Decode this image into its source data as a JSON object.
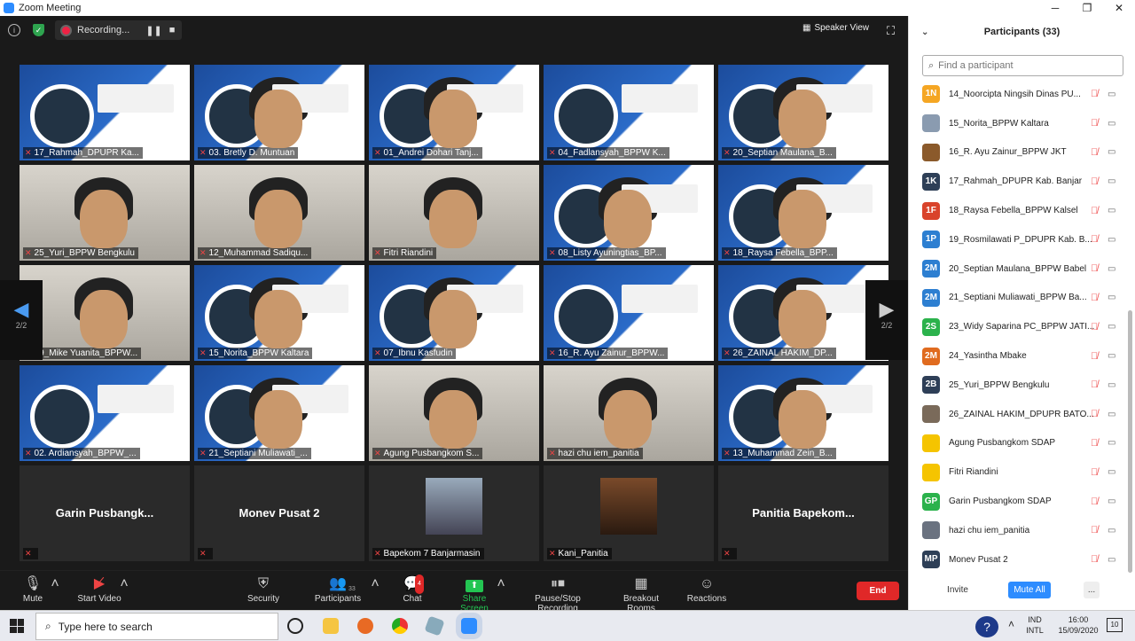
{
  "window": {
    "title": "Zoom Meeting",
    "minimize": "─",
    "maximize": "❐",
    "close": "✕"
  },
  "topbar": {
    "info": "i",
    "recording": "Recording...",
    "speaker_view": "Speaker View"
  },
  "tiles": [
    "17_Rahmah_DPUPR Ka...",
    "03. Bretly D. Muntuan",
    "01_Andrei Dohari Tanj...",
    "04_Fadlansyah_BPPW K...",
    "20_Septian Maulana_B...",
    "25_Yuri_BPPW Bengkulu",
    "12_Muhammad Sadiqu...",
    "Fitri Riandini",
    "08_Listy Ayuningtias_BP...",
    "18_Raysa Febella_BPP...",
    "09_Mike Yuanita_BPPW...",
    "15_Norita_BPPW Kaltara",
    "07_Ibnu Kasfudin",
    "16_R. Ayu Zainur_BPPW...",
    "26_ZAINAL HAKIM_DP...",
    "02. Ardiansyah_BPPW_...",
    "21_Septiani Muliawati_...",
    "Agung Pusbangkom S...",
    "hazi chu iem_panitia",
    "13_Muhammad Zein_B..."
  ],
  "empty_tiles": [
    "Garin  Pusbangk...",
    "Monev Pusat 2",
    "",
    "",
    "Panitia  Bapekom..."
  ],
  "picture_tiles": [
    "Bapekom 7 Banjarmasin",
    "Kani_Panitia"
  ],
  "page_indicator": "2/2",
  "toolbar": {
    "mute": "Mute",
    "start_video": "Start Video",
    "security": "Security",
    "participants": "Participants",
    "participants_count": "33",
    "chat": "Chat",
    "chat_badge": "4",
    "share": "Share Screen",
    "record": "Pause/Stop Recording",
    "breakout": "Breakout Rooms",
    "reactions": "Reactions",
    "end": "End"
  },
  "panel": {
    "title": "Participants (33)",
    "search_placeholder": "Find a participant",
    "participants": [
      {
        "initials": "1N",
        "color": "#f5a623",
        "name": "14_Noorcipta Ningsih Dinas PU..."
      },
      {
        "initials": "",
        "color": "#8a9bb0",
        "name": "15_Norita_BPPW Kaltara"
      },
      {
        "initials": "",
        "color": "#8b5a2b",
        "name": "16_R. Ayu Zainur_BPPW JKT"
      },
      {
        "initials": "1K",
        "color": "#2e3f57",
        "name": "17_Rahmah_DPUPR Kab. Banjar"
      },
      {
        "initials": "1F",
        "color": "#d9432b",
        "name": "18_Raysa Febella_BPPW Kalsel"
      },
      {
        "initials": "1P",
        "color": "#2d7fd1",
        "name": "19_Rosmilawati P_DPUPR Kab. B..."
      },
      {
        "initials": "2M",
        "color": "#2d7fd1",
        "name": "20_Septian Maulana_BPPW Babel"
      },
      {
        "initials": "2M",
        "color": "#2d7fd1",
        "name": "21_Septiani Muliawati_BPPW Ba..."
      },
      {
        "initials": "2S",
        "color": "#2bb24c",
        "name": "23_Widy Saparina PC_BPPW JATI..."
      },
      {
        "initials": "2M",
        "color": "#e06b1f",
        "name": "24_Yasintha Mbake"
      },
      {
        "initials": "2B",
        "color": "#2e3f57",
        "name": "25_Yuri_BPPW Bengkulu"
      },
      {
        "initials": "",
        "color": "#7a6a5a",
        "name": "26_ZAINAL HAKIM_DPUPR BATO..."
      },
      {
        "initials": "",
        "color": "#f5c400",
        "name": "Agung Pusbangkom SDAP"
      },
      {
        "initials": "",
        "color": "#f5c400",
        "name": "Fitri Riandini"
      },
      {
        "initials": "GP",
        "color": "#2bb24c",
        "name": "Garin Pusbangkom SDAP"
      },
      {
        "initials": "",
        "color": "#6a7280",
        "name": "hazi chu iem_panitia"
      },
      {
        "initials": "MP",
        "color": "#2e3f57",
        "name": "Monev Pusat 2"
      }
    ],
    "invite": "Invite",
    "mute_all": "Mute All",
    "more": "..."
  },
  "taskbar": {
    "search_placeholder": "Type here to search",
    "lang1": "IND",
    "lang2": "INTL",
    "time": "16:00",
    "date": "15/09/2020",
    "notif": "10"
  }
}
